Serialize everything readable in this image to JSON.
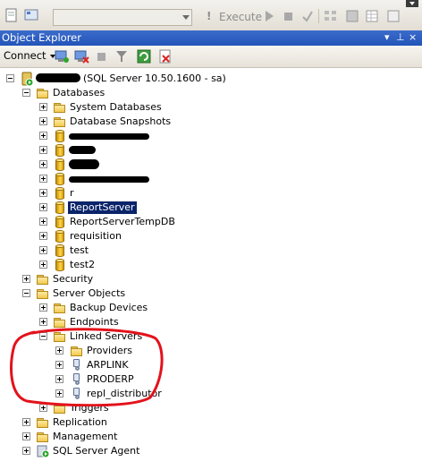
{
  "toolbar": {
    "execute_label": "Execute",
    "database_selector_value": ""
  },
  "panel": {
    "title": "Object Explorer",
    "pin_glyph": "▼ ⊥",
    "close_glyph": "×"
  },
  "explorer_toolbar": {
    "connect_label": "Connect",
    "icons": [
      "connect-icon",
      "disconnect-icon",
      "stop-icon",
      "filter-icon",
      "refresh-icon",
      "summary-icon"
    ]
  },
  "tree": {
    "server": {
      "label": "(SQL Server 10.50.1600 - sa)"
    },
    "databases": {
      "label": "Databases",
      "children": [
        "System Databases",
        "Database Snapshots",
        "",
        "",
        "",
        "",
        "r",
        "ReportServer",
        "ReportServerTempDB",
        "requisition",
        "test",
        "test2"
      ],
      "selected": "ReportServer"
    },
    "security": "Security",
    "server_objects": {
      "label": "Server Objects",
      "backup_devices": "Backup Devices",
      "endpoints": "Endpoints",
      "linked_servers": {
        "label": "Linked Servers",
        "providers": "Providers",
        "servers": [
          "ARPLINK",
          "PRODERP",
          "repl_distributor"
        ]
      },
      "triggers": "Triggers"
    },
    "replication": "Replication",
    "management": "Management",
    "sql_server_agent": "SQL Server Agent"
  },
  "colors": {
    "panel_title_bg": "#2354b8",
    "selection_bg": "#0a246a",
    "annotation_red": "#e3121b"
  }
}
